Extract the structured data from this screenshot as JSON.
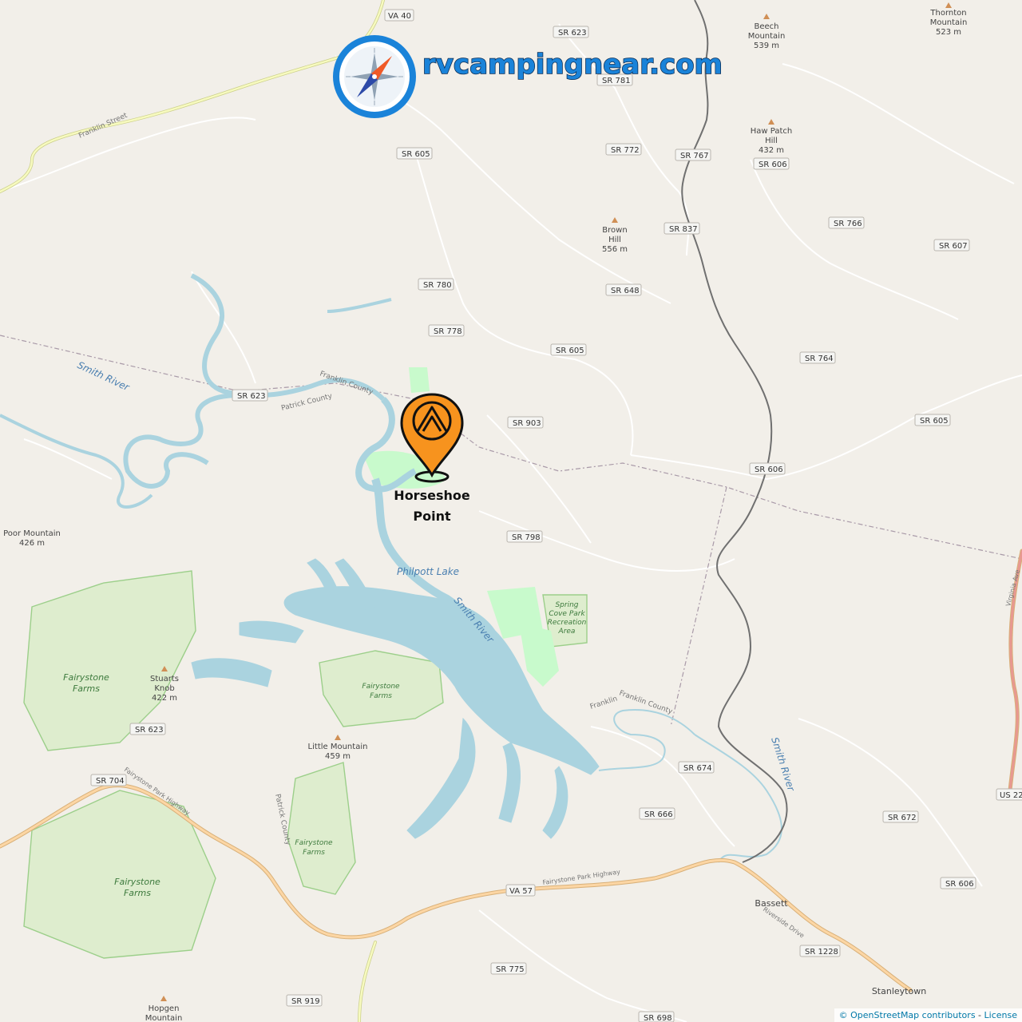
{
  "brand": {
    "name": "rvcampingnear.com"
  },
  "poi": {
    "name_line1": "Horseshoe",
    "name_line2": "Point",
    "icon": "campground-pin-icon",
    "color": "#f7931e"
  },
  "attribution": {
    "text": "© OpenStreetMap contributors",
    "separator": " - ",
    "license": "License"
  },
  "road_labels": [
    "VA 40",
    "SR 623",
    "SR 781",
    "SR 605",
    "SR 772",
    "SR 767",
    "SR 606",
    "SR 837",
    "SR 766",
    "SR 607",
    "SR 780",
    "SR 648",
    "SR 778",
    "SR 605",
    "SR 764",
    "SR 623",
    "SR 903",
    "SR 605",
    "SR 606",
    "SR 798",
    "SR 623",
    "SR 704",
    "SR 674",
    "SR 666",
    "SR 672",
    "US 22",
    "VA 57",
    "SR 606",
    "SR 1228",
    "SR 775",
    "SR 919",
    "SR 698"
  ],
  "peaks": [
    {
      "name": "Beech",
      "name2": "Mountain",
      "elev": "539 m"
    },
    {
      "name": "Thornton",
      "name2": "Mountain",
      "elev": "523 m"
    },
    {
      "name": "Haw Patch",
      "name2": "Hill",
      "elev": "432 m"
    },
    {
      "name": "Brown",
      "name2": "Hill",
      "elev": "556 m"
    },
    {
      "name": "Poor Mountain",
      "name2": "",
      "elev": "426 m"
    },
    {
      "name": "Stuarts",
      "name2": "Knob",
      "elev": "422 m"
    },
    {
      "name": "Little Mountain",
      "name2": "",
      "elev": "459 m"
    },
    {
      "name": "Hopgen",
      "name2": "Mountain",
      "elev": ""
    }
  ],
  "parks": [
    {
      "l1": "Fairystone",
      "l2": "Farms"
    },
    {
      "l1": "Fairystone",
      "l2": "Farms"
    },
    {
      "l1": "Fairystone",
      "l2": "Farms"
    },
    {
      "l1": "Fairystone",
      "l2": "Farms"
    },
    {
      "l1": "Spring",
      "l2": "Cove Park",
      "l3": "Recreation",
      "l4": "Area"
    }
  ],
  "water": {
    "lake": "Philpott Lake",
    "river1": "Smith River",
    "river2": "Smith River",
    "river3": "Smith River"
  },
  "counties": [
    "Franklin County",
    "Patrick County",
    "Patrick County",
    "Franklin",
    "Franklin County"
  ],
  "places": {
    "bassett": "Bassett",
    "stanleytown": "Stanleytown"
  },
  "street_names": {
    "franklin_street": "Franklin Street",
    "fairystone_hwy": "Fairystone Park Highway",
    "riverside": "Riverside Drive",
    "virginia_ave": "Virginia Ave"
  },
  "colors": {
    "land": "#f2efe9",
    "water": "#aad3df",
    "park": "#c8facc",
    "primary_road": "#fcd6a4",
    "secondary_road": "#f7fabf",
    "brand_blue": "#1a83d9",
    "marker_orange": "#f7931e"
  }
}
